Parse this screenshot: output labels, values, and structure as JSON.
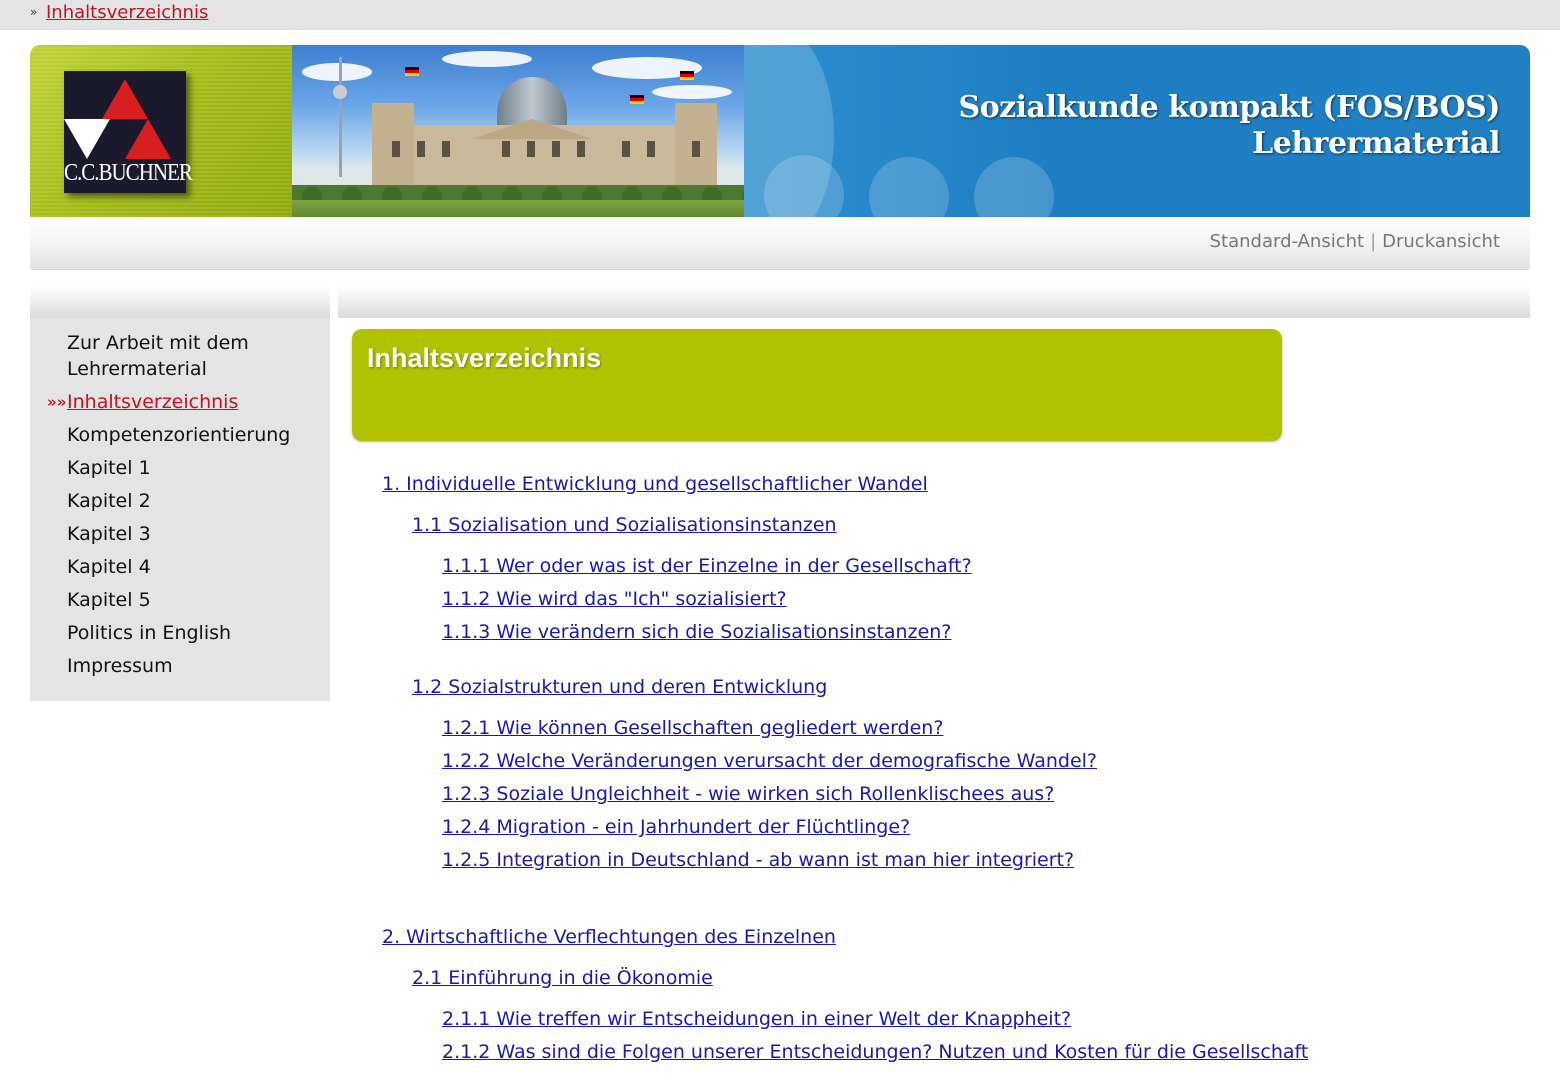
{
  "breadcrumb": {
    "marker": "»",
    "current": "Inhaltsverzeichnis"
  },
  "header": {
    "logo_text": "C.C.BUCHNER",
    "title_line1": "Sozialkunde kompakt (FOS/BOS)",
    "title_line2": "Lehrermaterial"
  },
  "view": {
    "standard": "Standard-Ansicht",
    "separator": "|",
    "print": "Druckansicht"
  },
  "sidebar": {
    "active_marker": "»»",
    "items": [
      {
        "label": "Zur Arbeit mit dem Lehrermaterial"
      },
      {
        "label": "Inhaltsverzeichnis"
      },
      {
        "label": "Kompetenzorientierung"
      },
      {
        "label": "Kapitel 1"
      },
      {
        "label": "Kapitel 2"
      },
      {
        "label": "Kapitel 3"
      },
      {
        "label": "Kapitel 4"
      },
      {
        "label": "Kapitel 5"
      },
      {
        "label": "Politics in English"
      },
      {
        "label": "Impressum"
      }
    ]
  },
  "page_title": "Inhaltsverzeichnis",
  "toc": [
    {
      "text": "1. Individuelle Entwicklung und gesellschaftlicher Wandel"
    },
    {
      "text": "1.1 Sozialisation und Sozialisationsinstanzen"
    },
    {
      "text": "1.1.1 Wer oder was ist der Einzelne in der Gesellschaft?"
    },
    {
      "text": "1.1.2 Wie wird das \"Ich\" sozialisiert?"
    },
    {
      "text": "1.1.3 Wie verändern sich die Sozialisationsinstanzen?"
    },
    {
      "text": "1.2 Sozialstrukturen und deren Entwicklung"
    },
    {
      "text": "1.2.1 Wie können Gesellschaften gegliedert werden?"
    },
    {
      "text": "1.2.2 Welche Veränderungen verursacht der demografische Wandel?"
    },
    {
      "text": "1.2.3 Soziale Ungleichheit - wie wirken sich Rollenklischees aus?"
    },
    {
      "text": "1.2.4 Migration - ein Jahrhundert der Flüchtlinge?"
    },
    {
      "text": "1.2.5 Integration in Deutschland - ab wann ist man hier integriert?"
    },
    {
      "text": "2. Wirtschaftliche Verflechtungen des Einzelnen"
    },
    {
      "text": "2.1 Einführung in die Ökonomie"
    },
    {
      "text": "2.1.1 Wie treffen wir Entscheidungen in einer Welt der Knappheit?"
    },
    {
      "text": "2.1.2 Was sind die Folgen unserer Entscheidungen? Nutzen und Kosten für die Gesellschaft"
    }
  ]
}
